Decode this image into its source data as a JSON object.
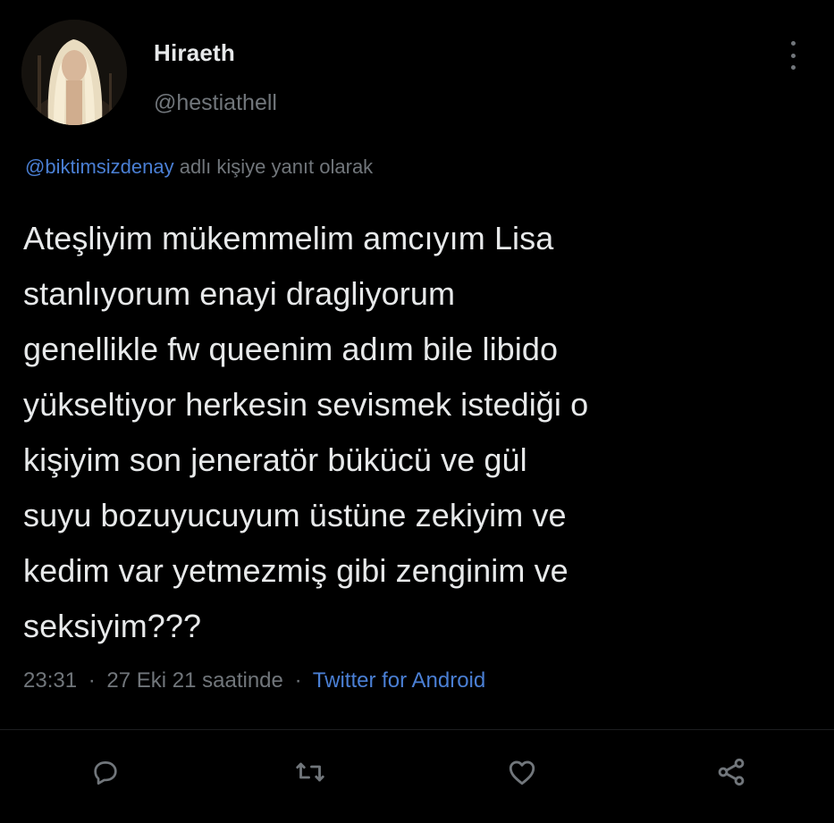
{
  "tweet": {
    "display_name": "Hiraeth",
    "handle": "@hestiathell",
    "reply_to": {
      "mention": "@biktimsizdenay",
      "suffix": "adlı kişiye yanıt olarak"
    },
    "body_lines": [
      "Ateşliyim mükemmelim amcıyım Lisa",
      "stanlıyorum enayi dragliyorum",
      "genellikle fw queenim adım bile libido",
      "yükseltiyor herkesin sevismek istediği o",
      "kişiyim son jeneratör bükücü ve gül",
      "suyu bozuyucuyum üstüne zekiyim ve",
      "kedim var yetmezmiş gibi zenginim ve",
      "seksiyim???"
    ],
    "time": "23:31",
    "date": "27 Eki 21 saatinde",
    "separator": "·",
    "source": "Twitter for Android"
  },
  "icons": {
    "more": "more-vertical-icon",
    "reply": "comment-icon",
    "retweet": "retweet-icon",
    "like": "heart-icon",
    "share": "share-icon"
  },
  "colors": {
    "background": "#000000",
    "text_primary": "#e7e9ea",
    "text_secondary": "#71767b",
    "link": "#4a7fd4"
  }
}
